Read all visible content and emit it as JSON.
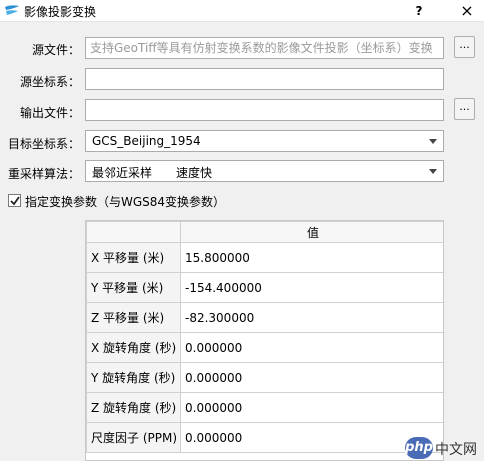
{
  "window": {
    "title": "影像投影变换",
    "help": "?",
    "close": "×"
  },
  "form": {
    "source_file": {
      "label": "源文件：",
      "placeholder": "支持GeoTiff等具有仿射变换系数的影像文件投影（坐标系）变换",
      "value": ""
    },
    "source_crs": {
      "label": "源坐标系：",
      "value": ""
    },
    "output_file": {
      "label": "输出文件：",
      "value": ""
    },
    "target_crs": {
      "label": "目标坐标系：",
      "value": "GCS_Beijing_1954"
    },
    "resample": {
      "label": "重采样算法：",
      "value": "最邻近采样",
      "note": "速度快"
    },
    "browse_label": "..."
  },
  "transform": {
    "checkbox_label": "指定变换参数（与WGS84变换参数）",
    "checked": true,
    "column_header": "值",
    "rows": [
      {
        "name": "X 平移量 (米)",
        "value": "15.800000"
      },
      {
        "name": "Y 平移量 (米)",
        "value": "-154.400000"
      },
      {
        "name": "Z 平移量 (米)",
        "value": "-82.300000"
      },
      {
        "name": "X 旋转角度 (秒)",
        "value": "0.000000"
      },
      {
        "name": "Y 旋转角度 (秒)",
        "value": "0.000000"
      },
      {
        "name": "Z 旋转角度 (秒)",
        "value": "0.000000"
      },
      {
        "name": "尺度因子 (PPM)",
        "value": "0.000000"
      }
    ]
  },
  "watermark": {
    "logo": "php",
    "text": "中文网"
  }
}
